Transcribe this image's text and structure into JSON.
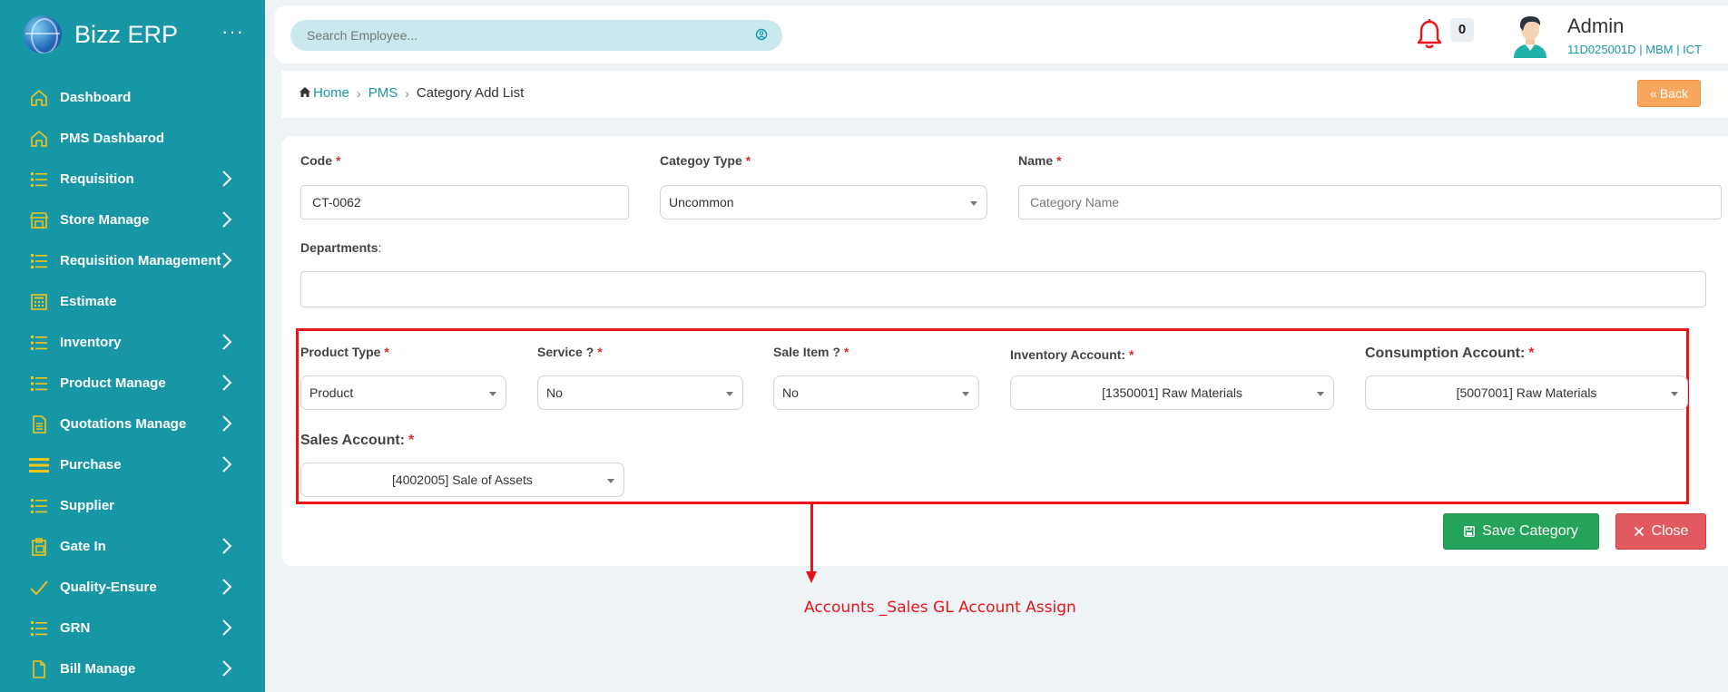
{
  "app": {
    "title": "Bizz ERP"
  },
  "sidebar": {
    "items": [
      {
        "label": "Dashboard",
        "icon": "home-icon",
        "has_children": false
      },
      {
        "label": "PMS Dashbarod",
        "icon": "home-icon",
        "has_children": false
      },
      {
        "label": "Requisition",
        "icon": "list-icon",
        "has_children": true
      },
      {
        "label": "Store Manage",
        "icon": "store-icon",
        "has_children": true
      },
      {
        "label": "Requisition Management",
        "icon": "list-icon",
        "has_children": true
      },
      {
        "label": "Estimate",
        "icon": "calculator-icon",
        "has_children": false
      },
      {
        "label": "Inventory",
        "icon": "list-icon",
        "has_children": true
      },
      {
        "label": "Product Manage",
        "icon": "list-icon",
        "has_children": true
      },
      {
        "label": "Quotations Manage",
        "icon": "document-icon",
        "has_children": true
      },
      {
        "label": "Purchase",
        "icon": "bars-icon",
        "has_children": true
      },
      {
        "label": "Supplier",
        "icon": "list-icon",
        "has_children": false
      },
      {
        "label": "Gate In",
        "icon": "clipboard-icon",
        "has_children": true
      },
      {
        "label": "Quality-Ensure",
        "icon": "check-icon",
        "has_children": true
      },
      {
        "label": "GRN",
        "icon": "list-icon",
        "has_children": true
      },
      {
        "label": "Bill Manage",
        "icon": "file-icon",
        "has_children": true
      }
    ]
  },
  "header": {
    "search_placeholder": "Search Employee...",
    "notification_count": "0",
    "user_name": "Admin",
    "user_meta": "11D025001D | MBM  | ICT"
  },
  "breadcrumb": {
    "home": "Home",
    "pms": "PMS",
    "current": "Category Add List",
    "back_label": "Back"
  },
  "form": {
    "code_label": "Code",
    "code_value": "CT-0062",
    "category_type_label": "Categoy Type",
    "category_type_value": "Uncommon",
    "name_label": "Name",
    "name_placeholder": "Category Name",
    "departments_label": "Departments",
    "departments_suffix": ":",
    "product_type_label": "Product Type",
    "product_type_value": "Product",
    "service_label": "Service ?",
    "service_value": "No",
    "sale_item_label": "Sale Item ?",
    "sale_item_value": "No",
    "inventory_account_label": "Inventory Account:",
    "inventory_account_value": "[1350001] Raw Materials",
    "consumption_account_label": "Consumption Account:",
    "consumption_account_value": "[5007001] Raw Materials",
    "sales_account_label": "Sales Account:",
    "sales_account_value": "[4002005] Sale of Assets",
    "required_mark": "*",
    "save_label": "Save Category",
    "close_label": "Close"
  },
  "annotation": {
    "text": "Accounts _Sales GL Account Assign"
  },
  "colors": {
    "sidebar": "#1797a6",
    "accent_icon": "#f5c518",
    "highlight": "#e8141a",
    "save": "#26a35a",
    "close": "#e05a5f",
    "back": "#f8a65e"
  }
}
